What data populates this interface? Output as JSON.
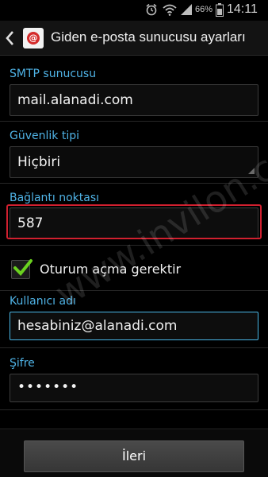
{
  "status_bar": {
    "battery_percent": "66%",
    "time": "14:11",
    "icons": [
      "alarm-icon",
      "wifi-icon",
      "signal-icon",
      "battery-icon"
    ]
  },
  "header": {
    "title": "Giden e-posta sunucusu ayarları",
    "back_icon": "chevron-left-icon",
    "app_icon": "email-app-icon"
  },
  "form": {
    "smtp_server": {
      "label": "SMTP sunucusu",
      "value": "mail.alanadi.com"
    },
    "security_type": {
      "label": "Güvenlik tipi",
      "value": "Hiçbiri"
    },
    "port": {
      "label": "Bağlantı noktası",
      "value": "587"
    },
    "require_login": {
      "label": "Oturum açma gerektir",
      "checked": true
    },
    "username": {
      "label": "Kullanıcı adı",
      "value": "hesabiniz@alanadi.com"
    },
    "password": {
      "label": "Şifre",
      "value": "•••••••"
    }
  },
  "footer": {
    "next_label": "İleri"
  },
  "watermark": "www.invilon.com",
  "colors": {
    "label": "#4fb3e6",
    "highlight": "#d0202f",
    "check": "#6ad11f",
    "focus": "#49b6e6"
  }
}
